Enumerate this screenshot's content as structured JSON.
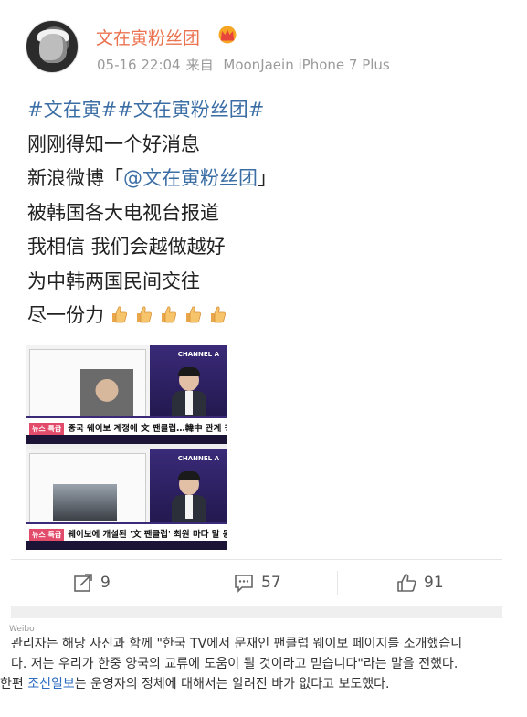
{
  "header": {
    "author": "文在寅粉丝团",
    "timestamp": "05-16 22:04",
    "source_prefix": "来自",
    "device": "MoonJaein iPhone 7 Plus",
    "badge_icon": "crown-icon"
  },
  "post": {
    "hashtags": "#文在寅##文在寅粉丝团#",
    "line1": "刚刚得知一个好消息",
    "line2_prefix": "新浪微博「",
    "line2_mention": "@文在寅粉丝团",
    "line2_suffix": "」",
    "line3": "被韩国各大电视台报道",
    "line4": "我相信 我们会越做越好",
    "line5": "为中韩两国民间交往",
    "line6": "尽一份力",
    "emoji": "thumbs-up-icon",
    "emoji_count": 5
  },
  "media": {
    "panel1_tag": "뉴스 특급",
    "panel1_caption": "중국 웨이보 계정에 文 팬클럽…韓中 관계 청신호?",
    "panel2_tag": "뉴스 특급",
    "panel2_caption": "웨이보에 개설된 '文 팬클럽' 최원 마다 말 동표",
    "channel_logo": "CHANNEL A"
  },
  "actions": {
    "reposts": "9",
    "comments": "57",
    "likes": "91"
  },
  "article": {
    "source_label": "Weibo",
    "line1": "관리자는 해당 사진과 함께 \"한국 TV에서 문재인 팬클럽 웨이보 페이지를 소개했습니",
    "line2": "다. 저는 우리가 한중 양국의 교류에 도움이 될 것이라고 믿습니다\"라는 말을 전했다.",
    "line3_prefix": "한편 ",
    "line3_link": "조선일보",
    "line3_suffix": "는 운영자의 정체에 대해서는 알려진 바가 없다고 보도했다."
  },
  "colors": {
    "author": "#eb7350",
    "link": "#3b6ea5",
    "meta": "#9a9a9a",
    "news_link": "#2a6bbf"
  }
}
